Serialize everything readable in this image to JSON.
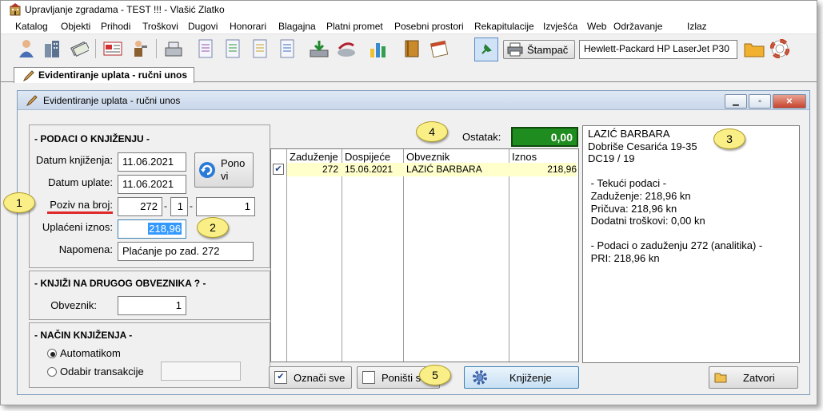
{
  "app": {
    "title": "Upravljanje zgradama - TEST !!! - Vlašić Zlatko",
    "menu": [
      "Katalog",
      "Objekti",
      "Prihodi",
      "Troškovi",
      "Dugovi",
      "Honorari",
      "Blagajna",
      "Platni promet",
      "Posebni prostori",
      "Rekapitulacije",
      "Izvješća",
      "Web",
      "Održavanje",
      "Izlaz"
    ],
    "print_label": "Štampač",
    "printer_name": "Hewlett-Packard HP LaserJet P30",
    "tab_label": "Evidentiranje uplata - ručni unos"
  },
  "dialog": {
    "title": "Evidentiranje uplata - ručni unos",
    "section1_title": "- PODACI O KNJIŽENJU -",
    "datum_knjizenja_label": "Datum knjiženja:",
    "datum_knjizenja": "11.06.2021",
    "datum_uplate_label": "Datum uplate:",
    "datum_uplate": "11.06.2021",
    "ponovi_label_1": "Pono",
    "ponovi_label_2": "vi",
    "poziv_label": "Poziv na broj:",
    "poziv_1": "272",
    "poziv_2": "1",
    "poziv_3": "1",
    "dash": "-",
    "uplaceni_label": "Uplaćeni iznos:",
    "uplaceni_iznos": "218,96",
    "napomena_label": "Napomena:",
    "napomena": "Plaćanje po zad. 272",
    "section2_title": "- KNJIŽI NA DRUGOG OBVEZNIKA ? -",
    "obveznik_label": "Obveznik:",
    "obveznik": "1",
    "section3_title": "- NAČIN KNJIŽENJA -",
    "radio_auto": "Automatikom",
    "radio_odabir": "Odabir transakcije",
    "ostatak_label": "Ostatak:",
    "ostatak": "0,00",
    "grid_headers": [
      "Zaduženje",
      "Dospijeće",
      "Obveznik",
      "Iznos"
    ],
    "grid_row": {
      "zaduzenje": "272",
      "dospijece": "15.06.2021",
      "obveznik": "LAZIĆ BARBARA",
      "iznos": "218,96",
      "checked": true
    },
    "info_text": "LAZIĆ BARBARA\nDobriše Cesarića 19-35\nDC19 / 19\n\n - Tekući podaci -\n Zaduženje: 218,96 kn\n Pričuva: 218,96 kn\n Dodatni troškovi: 0,00 kn\n\n - Podaci o zaduženju 272 (analitika) -\n PRI: 218,96 kn",
    "oznaci_sve": "Označi sve",
    "ponisti_sve": "Poništi sve",
    "knjizenje": "Knjiženje",
    "zatvori": "Zatvori"
  },
  "callouts": [
    "1",
    "2",
    "3",
    "4",
    "5"
  ],
  "colors": {
    "ostatak_bg": "#1e8c1e",
    "selection_row": "#ffffcc",
    "callout": "#f9ef86",
    "underline": "#e0292a"
  }
}
